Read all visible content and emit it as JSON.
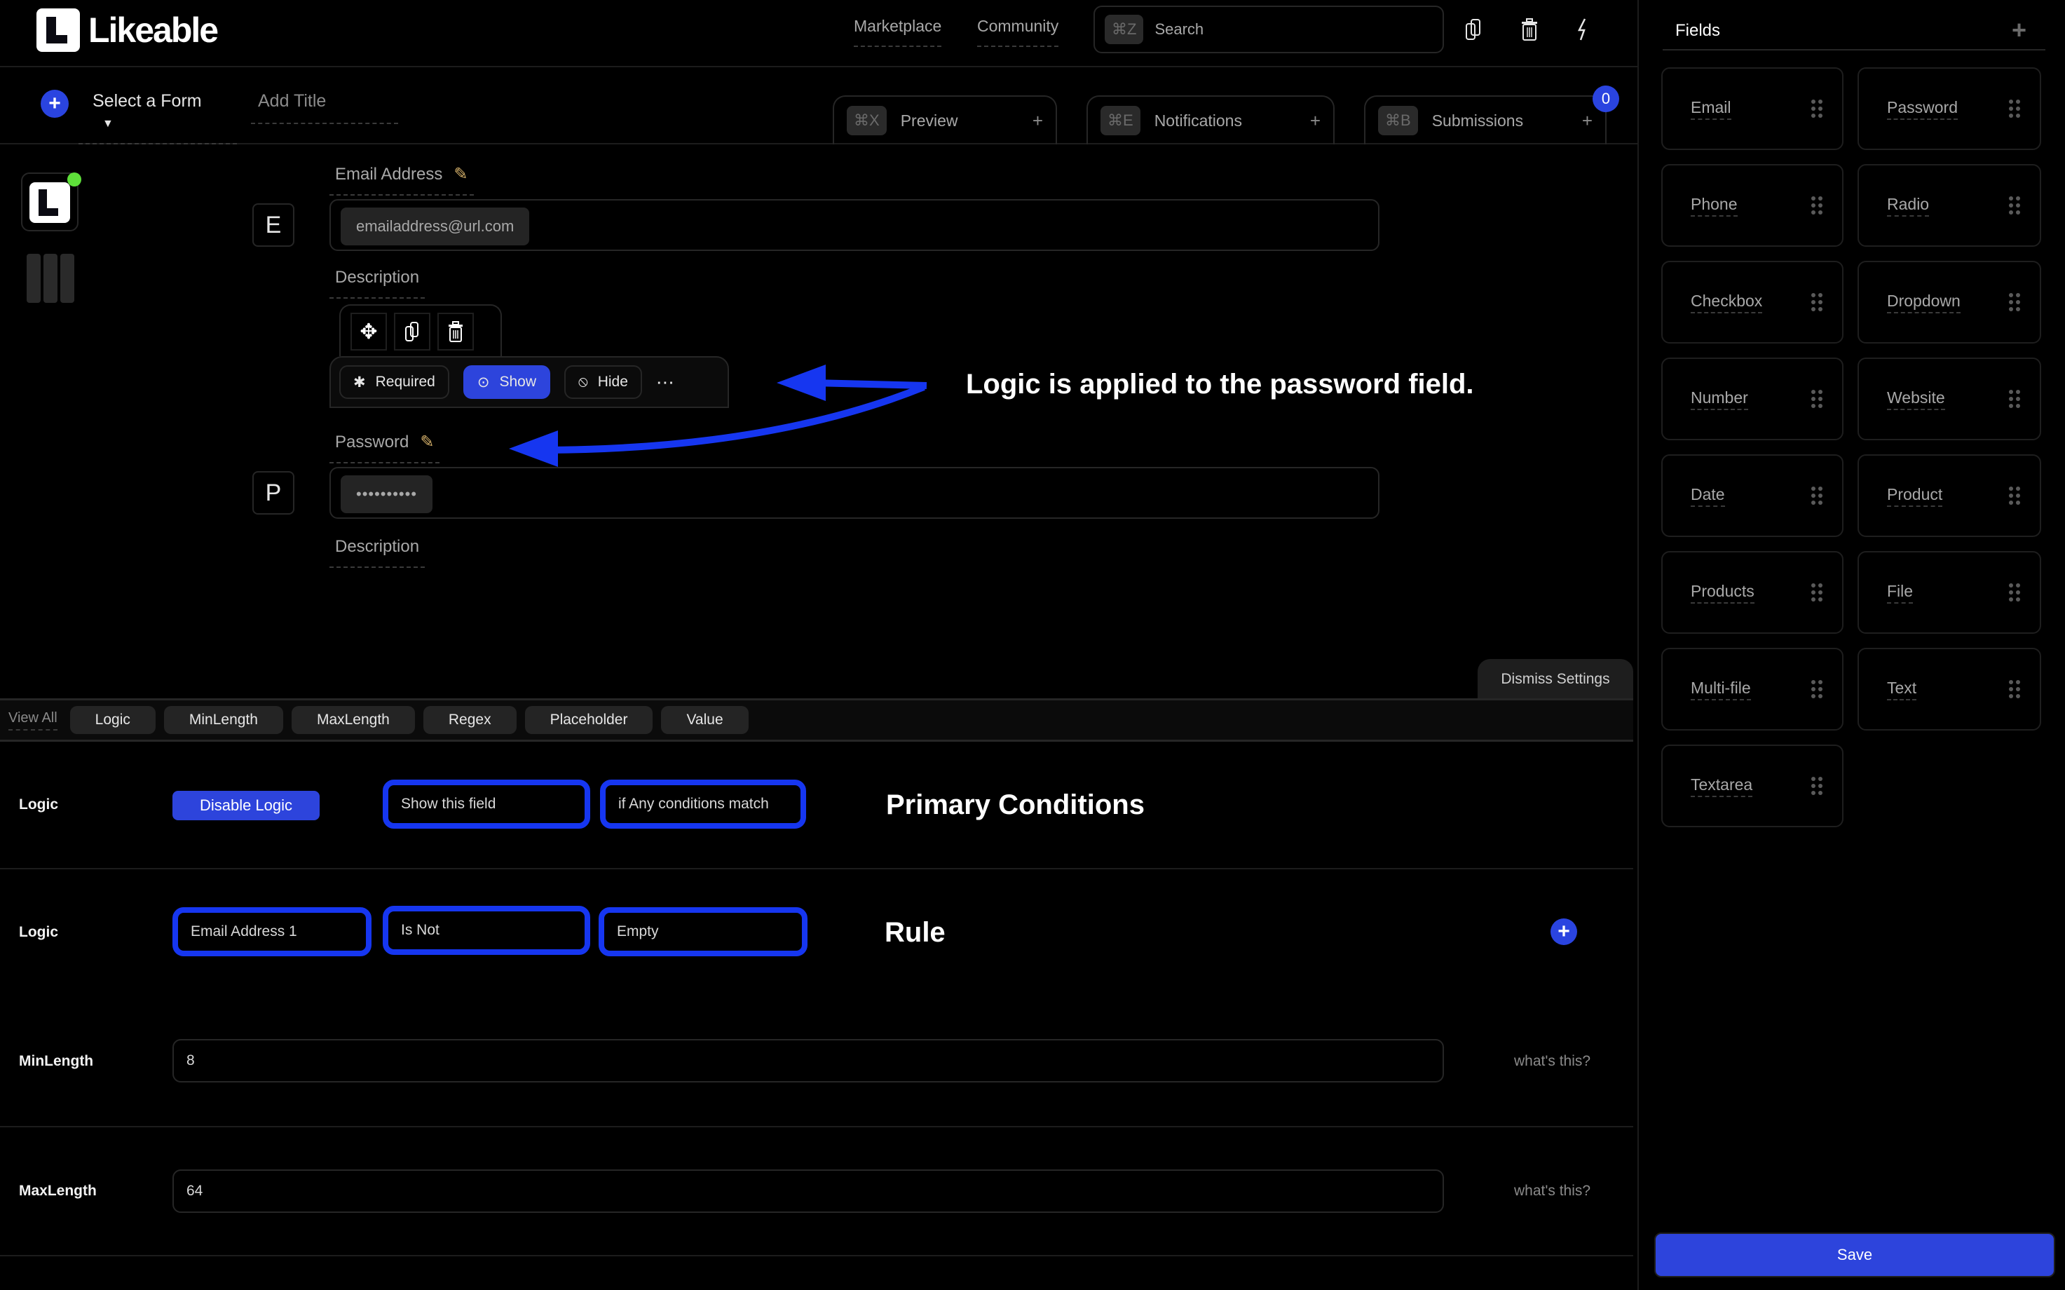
{
  "app": {
    "name": "Likeable"
  },
  "header": {
    "nav": [
      {
        "label": "Marketplace"
      },
      {
        "label": "Community"
      }
    ],
    "search": {
      "shortcut": "⌘Z",
      "placeholder": "Search"
    },
    "icons": [
      "copy-icon",
      "trash-icon",
      "lightning-icon"
    ]
  },
  "subbar": {
    "select_form": "Select a Form",
    "add_title": "Add Title",
    "tabs": [
      {
        "shortcut": "⌘X",
        "label": "Preview"
      },
      {
        "shortcut": "⌘E",
        "label": "Notifications"
      },
      {
        "shortcut": "⌘B",
        "label": "Submissions"
      }
    ],
    "submissions_count": "0"
  },
  "form": {
    "fields": [
      {
        "letter": "E",
        "label": "Email Address",
        "value": "emailaddress@url.com",
        "description": "Description"
      },
      {
        "letter": "P",
        "label": "Password",
        "value": "••••••••••",
        "description": "Description"
      }
    ],
    "field_rules": {
      "required": "Required",
      "show": "Show",
      "hide": "Hide",
      "more": "⋯",
      "active": "show"
    }
  },
  "annotations": {
    "applied": "Logic is applied to the password field.",
    "primary": "Primary Conditions",
    "rule": "Rule"
  },
  "settings": {
    "dismiss": "Dismiss Settings",
    "view_all": "View All",
    "tabs": [
      "Logic",
      "MinLength",
      "MaxLength",
      "Regex",
      "Placeholder",
      "Value"
    ],
    "logic_primary": {
      "label": "Logic",
      "disable_button": "Disable Logic",
      "action": "Show this field",
      "match": "if Any conditions match"
    },
    "logic_rule": {
      "label": "Logic",
      "field": "Email Address 1",
      "operator": "Is Not",
      "value": "Empty"
    },
    "min_length": {
      "label": "MinLength",
      "value": "8",
      "help": "what's this?"
    },
    "max_length": {
      "label": "MaxLength",
      "value": "64",
      "help": "what's this?"
    }
  },
  "sidebar": {
    "title": "Fields",
    "add": "+",
    "fields": [
      "Email",
      "Password",
      "Phone",
      "Radio",
      "Checkbox",
      "Dropdown",
      "Number",
      "Website",
      "Date",
      "Product",
      "Products",
      "File",
      "Multi-file",
      "Text",
      "Textarea"
    ],
    "save": "Save"
  },
  "colors": {
    "accent": "#2d44dc",
    "highlight": "#1636f0",
    "status_online": "#5ee03a",
    "pencil": "#d4b06a"
  }
}
